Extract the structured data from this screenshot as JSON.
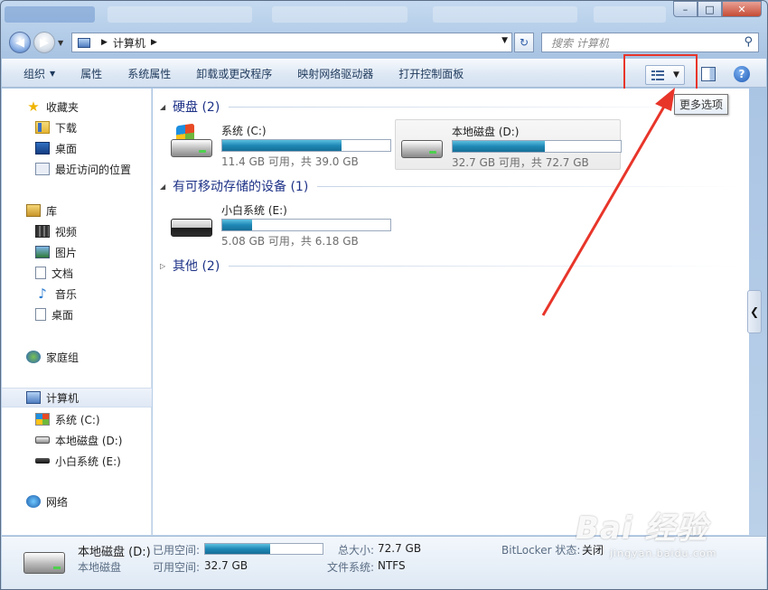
{
  "titlebar": {
    "min_glyph": "–",
    "max_glyph": "□",
    "close_glyph": "✕"
  },
  "address": {
    "path_label": "计算机",
    "search_placeholder": "搜索 计算机"
  },
  "toolbar": {
    "organize": "组织",
    "properties": "属性",
    "system_properties": "系统属性",
    "uninstall": "卸载或更改程序",
    "map_drive": "映射网络驱动器",
    "control_panel": "打开控制面板",
    "more_options_tooltip": "更多选项",
    "help_glyph": "?"
  },
  "sidebar": {
    "favorites": "收藏夹",
    "downloads": "下载",
    "desktop": "桌面",
    "recent": "最近访问的位置",
    "libraries": "库",
    "videos": "视频",
    "pictures": "图片",
    "documents": "文档",
    "music": "音乐",
    "lib_desktop": "桌面",
    "homegroup": "家庭组",
    "computer": "计算机",
    "drive_c": "系统 (C:)",
    "drive_d": "本地磁盘 (D:)",
    "drive_e": "小白系统 (E:)",
    "network": "网络"
  },
  "content": {
    "group_hdd": "硬盘 (2)",
    "group_removable": "有可移动存储的设备 (1)",
    "group_other": "其他 (2)",
    "drives": [
      {
        "name": "系统 (C:)",
        "free": "11.4 GB 可用，共 39.0 GB",
        "used_fraction": 0.71
      },
      {
        "name": "本地磁盘 (D:)",
        "free": "32.7 GB 可用，共 72.7 GB",
        "used_fraction": 0.55
      },
      {
        "name": "小白系统 (E:)",
        "free": "5.08 GB 可用，共 6.18 GB",
        "used_fraction": 0.18
      }
    ]
  },
  "details": {
    "name": "本地磁盘 (D:)",
    "type": "本地磁盘",
    "used_label": "已用空间:",
    "free_label": "可用空间:",
    "free_value": "32.7 GB",
    "total_label": "总大小:",
    "total_value": "72.7 GB",
    "fs_label": "文件系统:",
    "fs_value": "NTFS",
    "bitlocker_label": "BitLocker 状态:",
    "bitlocker_value": "关闭",
    "used_fraction": 0.55
  },
  "watermark": {
    "logo_text": "Bai 经验",
    "url_text": "jingyan.baidu.com"
  },
  "colors": {
    "highlight_box": "#e8352a",
    "arrow": "#e8352a"
  }
}
